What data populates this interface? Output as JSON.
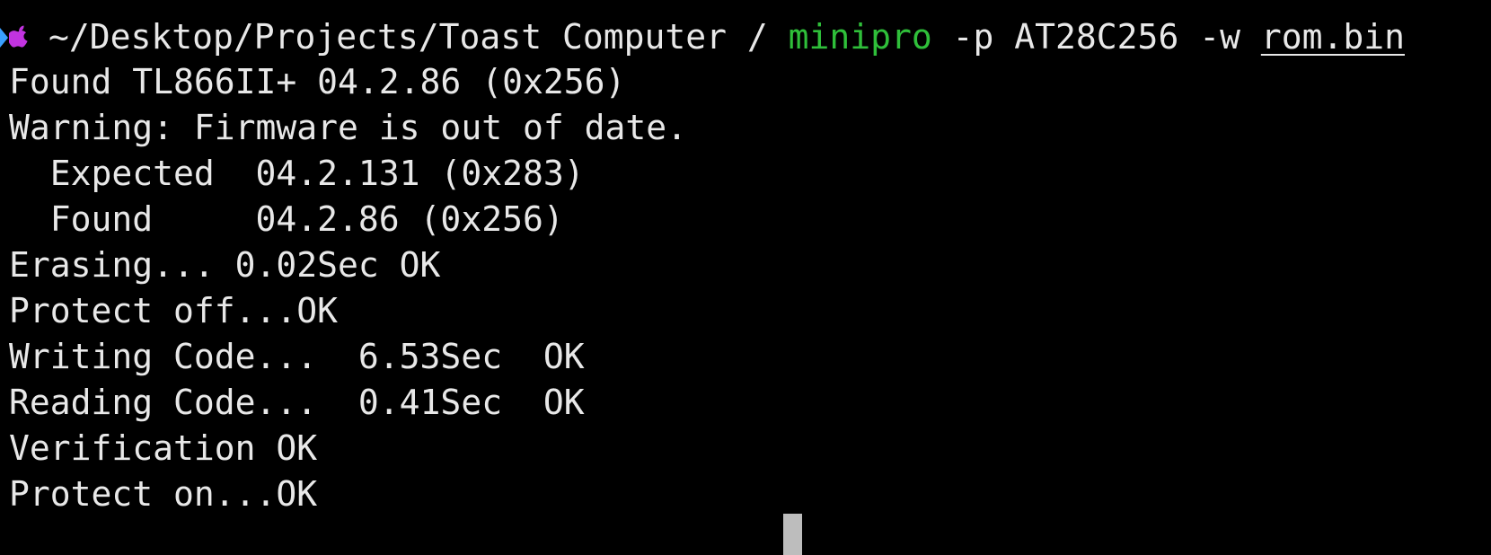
{
  "terminal": {
    "prompt": {
      "path": "~/Desktop/Projects/Toast Computer /",
      "command": "minipro",
      "args": " -p AT28C256 -w ",
      "file": "rom.bin"
    },
    "output": [
      "Found TL866II+ 04.2.86 (0x256)",
      "Warning: Firmware is out of date.",
      "  Expected  04.2.131 (0x283)",
      "  Found     04.2.86 (0x256)",
      "Erasing... 0.02Sec OK",
      "Protect off...OK",
      "Writing Code...  6.53Sec  OK",
      "Reading Code...  0.41Sec  OK",
      "Verification OK",
      "Protect on...OK"
    ],
    "colors": {
      "background": "#000000",
      "text": "#e8e8e8",
      "command": "#2fbf3a",
      "prompt_arrow": "#3aa0ff",
      "apple_logo": "#c233e0",
      "cursor": "#bdbdbd"
    }
  }
}
